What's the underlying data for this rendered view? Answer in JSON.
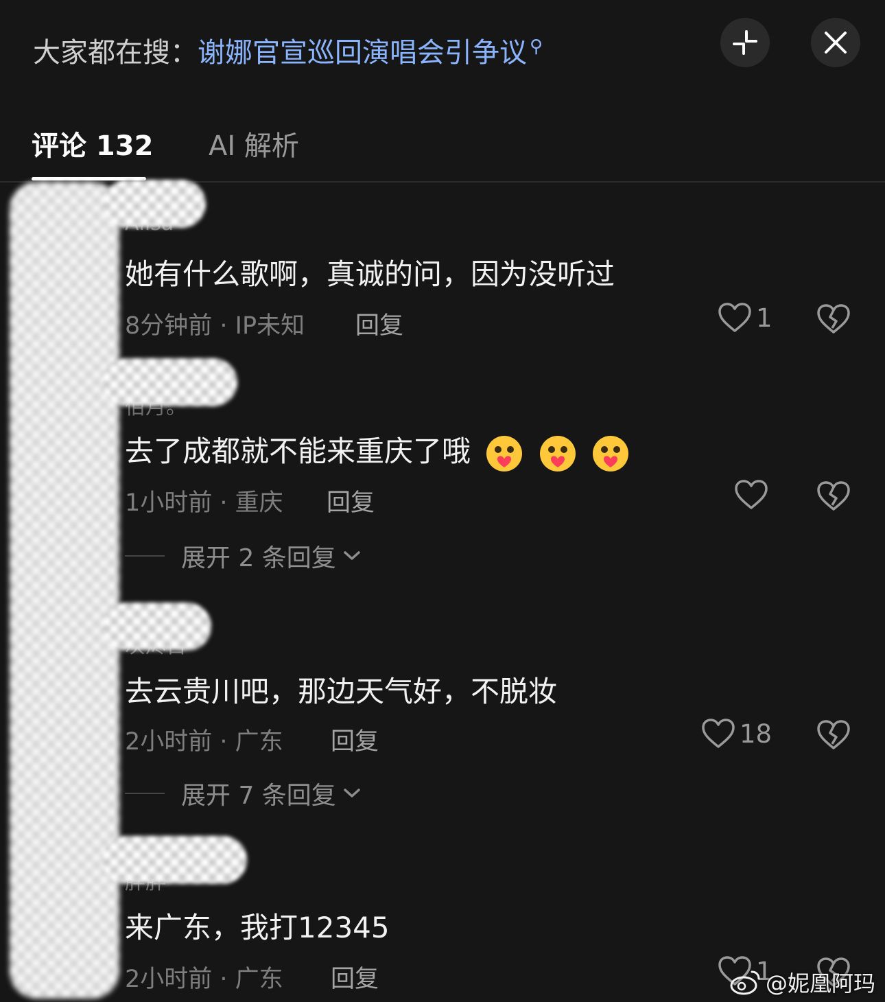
{
  "header": {
    "search_prefix": "大家都在搜：",
    "search_query": "谢娜官宣巡回演唱会引争议",
    "collapse_icon": "collapse-icon",
    "close_icon": "close-icon"
  },
  "tabs": [
    {
      "label": "评论 132",
      "active": true
    },
    {
      "label": "AI 解析",
      "active": false
    }
  ],
  "comments": [
    {
      "username": "Alisa",
      "text": "她有什么歌啊，真诚的问，因为没听过",
      "emojis": 0,
      "time_location": "8分钟前 · IP未知",
      "reply_label": "回复",
      "likes": "1"
    },
    {
      "username": "佰月。",
      "text": "去了成都就不能来重庆了哦",
      "emojis": 3,
      "time_location": "1小时前 · 重庆",
      "reply_label": "回复",
      "likes": "",
      "expand_label": "展开 2 条回复"
    },
    {
      "username": "灰烬百",
      "text": "去云贵川吧，那边天气好，不脱妆",
      "emojis": 0,
      "time_location": "2小时前 · 广东",
      "reply_label": "回复",
      "likes": "18",
      "expand_label": "展开 7 条回复"
    },
    {
      "username": "胖胖",
      "text": "来广东，我打12345",
      "emojis": 0,
      "time_location": "2小时前 · 广东",
      "reply_label": "回复",
      "likes": "1"
    }
  ],
  "watermark": "@妮凰阿玛",
  "colors": {
    "background": "#161616",
    "accent_link": "#8ab4ff",
    "text_primary": "#f2f2f2",
    "text_secondary": "#7e7e7e"
  }
}
